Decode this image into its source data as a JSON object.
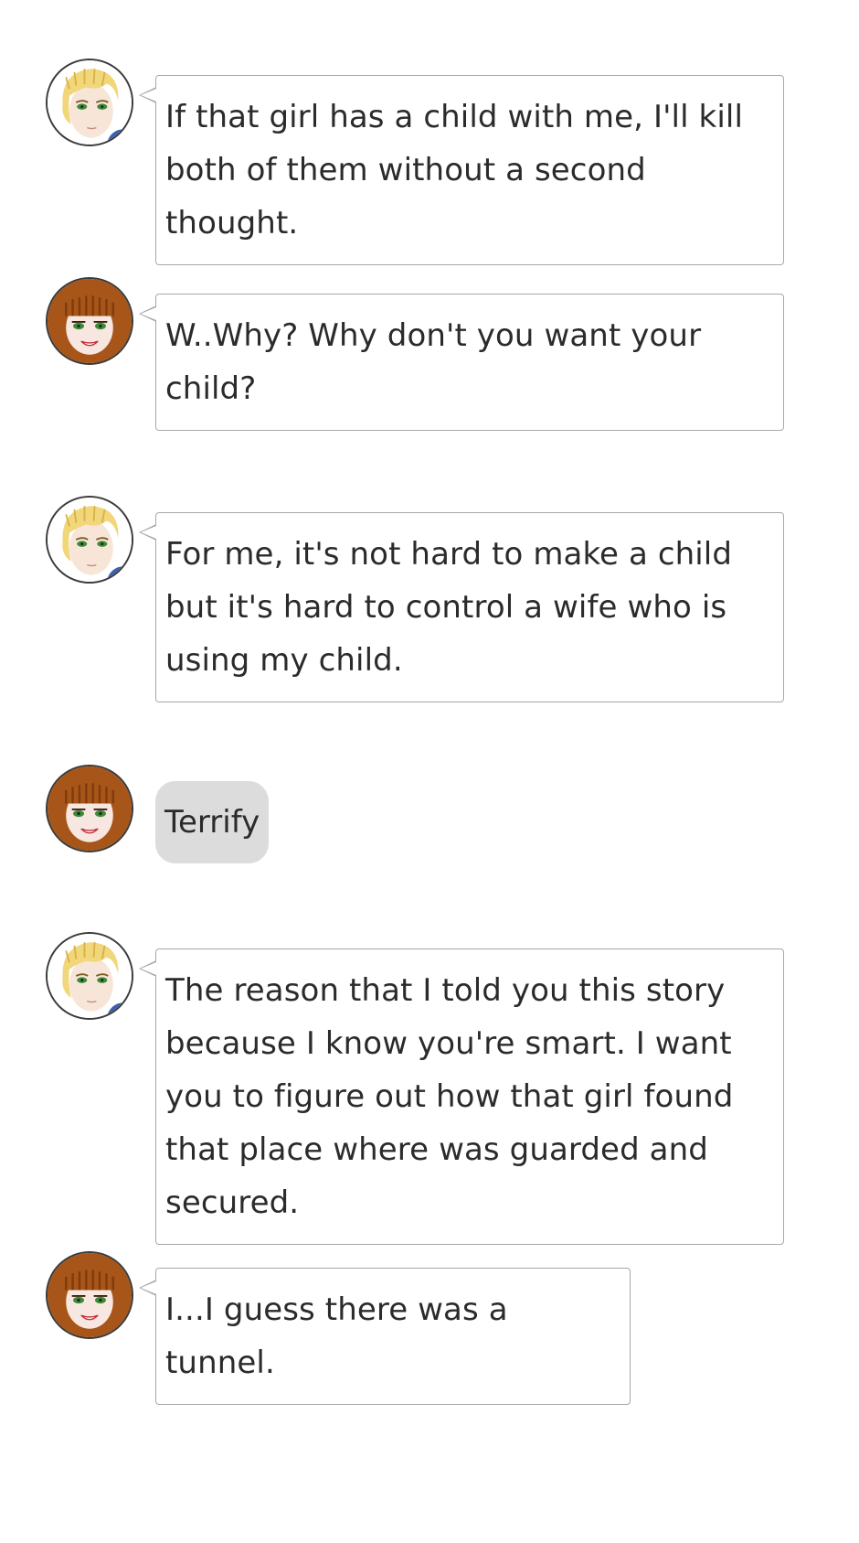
{
  "characters": {
    "blonde": {
      "icon": "blonde-man-avatar-icon",
      "hair": "#f1d67a",
      "skin": "#f7e6d8",
      "eyes": "#3f8a3a"
    },
    "redhead": {
      "icon": "redhead-girl-avatar-icon",
      "hair": "#a75518",
      "skin": "#f8e7e1",
      "eyes": "#3f8a3a"
    }
  },
  "colors": {
    "bubble_border": "#a8a8a8",
    "action_bg": "#dcdcdc",
    "text": "#2b2b2b"
  },
  "messages": [
    {
      "speaker": "blonde",
      "kind": "speech",
      "text": "If that girl has a child with me, I'll kill both of them without a second thought."
    },
    {
      "speaker": "redhead",
      "kind": "speech",
      "text": "W..Why? Why don't you want your child?"
    },
    {
      "speaker": "blonde",
      "kind": "speech",
      "text": "For me, it's not hard to make a child but it's hard to control a wife who is using my child."
    },
    {
      "speaker": "redhead",
      "kind": "action",
      "text": "Terrify"
    },
    {
      "speaker": "blonde",
      "kind": "speech",
      "text": "The reason that I told you this story because I know you're smart. I want you to figure out how that girl found that place where was guarded and secured."
    },
    {
      "speaker": "redhead",
      "kind": "speech",
      "text": "I...I guess there was a tunnel."
    }
  ]
}
